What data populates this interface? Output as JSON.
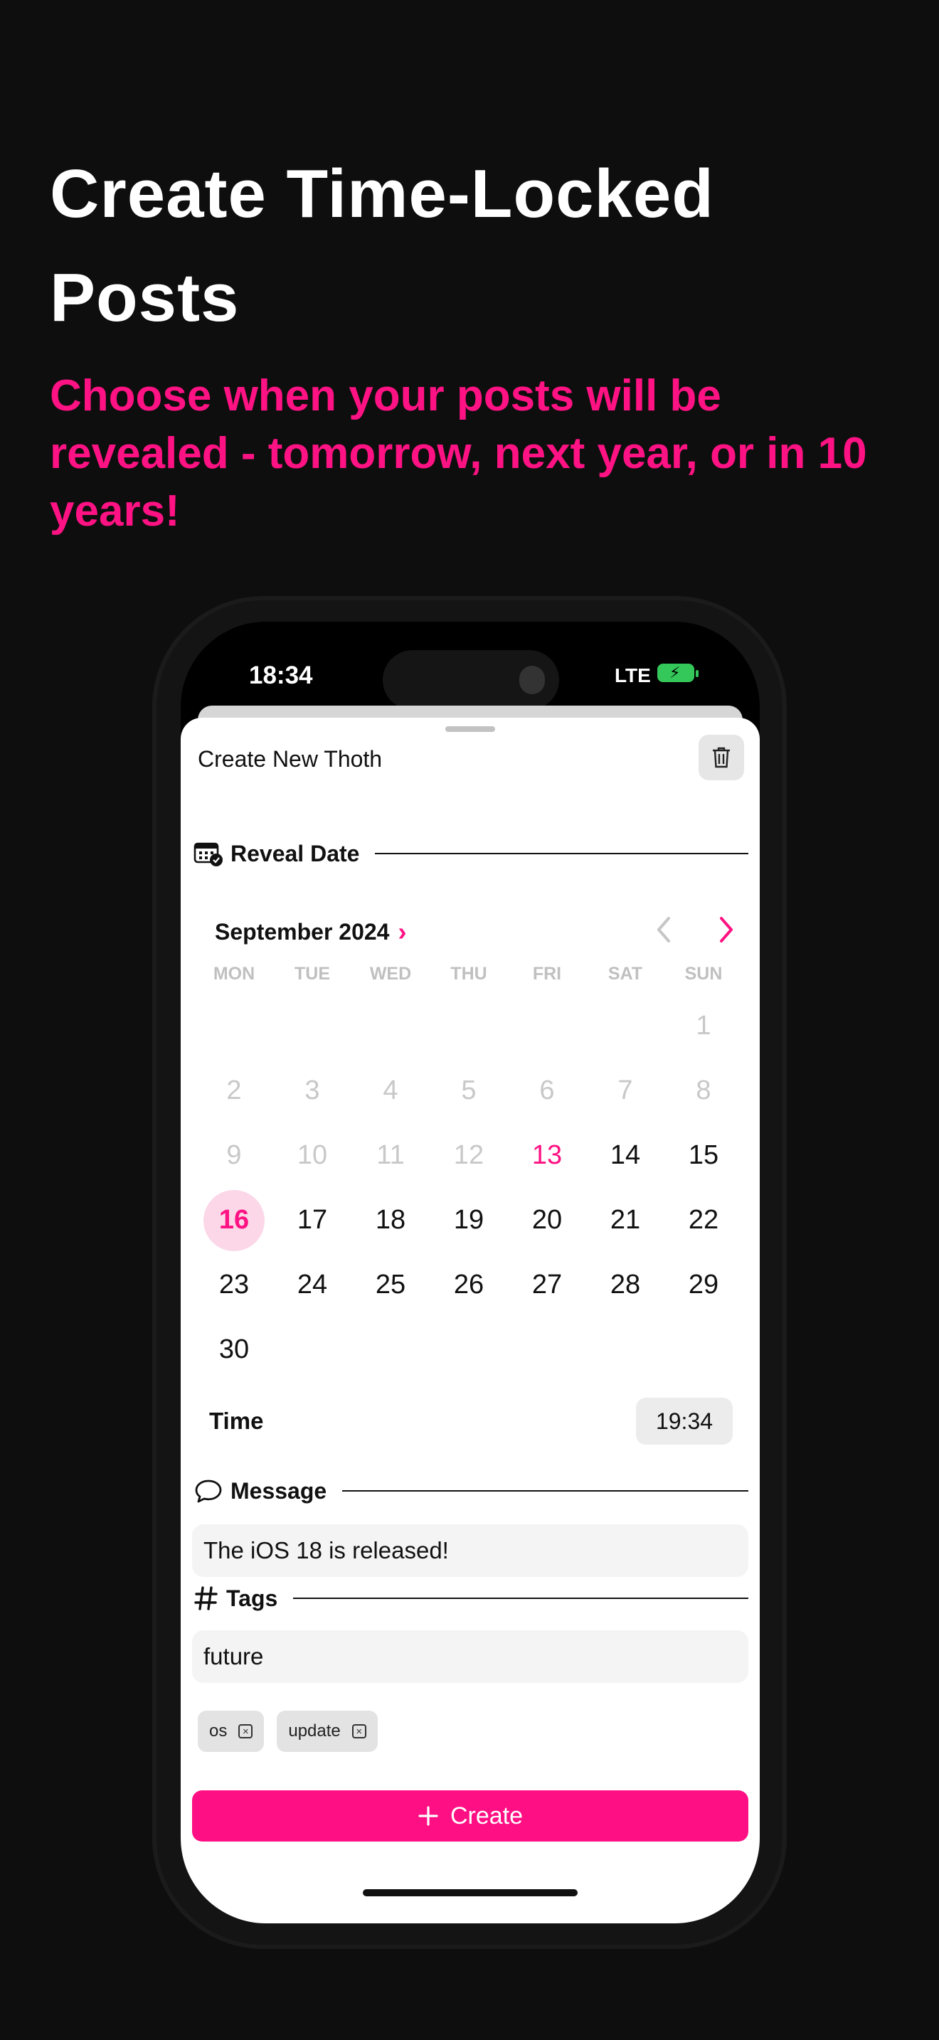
{
  "headline": "Create Time-Locked Posts",
  "subheadline": "Choose when your posts will be revealed - tomorrow, next year, or in 10 years!",
  "colors": {
    "accent": "#ff1283",
    "background": "#0e0e0e"
  },
  "status_bar": {
    "time": "18:34",
    "network": "LTE",
    "battery_icon": "battery-charging-icon"
  },
  "sheet": {
    "title": "Create New Thoth",
    "delete_icon": "trash-icon"
  },
  "reveal_date": {
    "label": "Reveal Date",
    "icon": "calendar-check-icon"
  },
  "calendar": {
    "month_label": "September 2024",
    "weekdays": [
      "MON",
      "TUE",
      "WED",
      "THU",
      "FRI",
      "SAT",
      "SUN"
    ],
    "days": [
      {
        "v": "",
        "s": "empty"
      },
      {
        "v": "",
        "s": "empty"
      },
      {
        "v": "",
        "s": "empty"
      },
      {
        "v": "",
        "s": "empty"
      },
      {
        "v": "",
        "s": "empty"
      },
      {
        "v": "",
        "s": "empty"
      },
      {
        "v": "1",
        "s": "dim"
      },
      {
        "v": "2",
        "s": "dim"
      },
      {
        "v": "3",
        "s": "dim"
      },
      {
        "v": "4",
        "s": "dim"
      },
      {
        "v": "5",
        "s": "dim"
      },
      {
        "v": "6",
        "s": "dim"
      },
      {
        "v": "7",
        "s": "dim"
      },
      {
        "v": "8",
        "s": "dim"
      },
      {
        "v": "9",
        "s": "dim"
      },
      {
        "v": "10",
        "s": "dim"
      },
      {
        "v": "11",
        "s": "dim"
      },
      {
        "v": "12",
        "s": "dim"
      },
      {
        "v": "13",
        "s": "today"
      },
      {
        "v": "14",
        "s": "normal"
      },
      {
        "v": "15",
        "s": "normal"
      },
      {
        "v": "16",
        "s": "sel"
      },
      {
        "v": "17",
        "s": "normal"
      },
      {
        "v": "18",
        "s": "normal"
      },
      {
        "v": "19",
        "s": "normal"
      },
      {
        "v": "20",
        "s": "normal"
      },
      {
        "v": "21",
        "s": "normal"
      },
      {
        "v": "22",
        "s": "normal"
      },
      {
        "v": "23",
        "s": "normal"
      },
      {
        "v": "24",
        "s": "normal"
      },
      {
        "v": "25",
        "s": "normal"
      },
      {
        "v": "26",
        "s": "normal"
      },
      {
        "v": "27",
        "s": "normal"
      },
      {
        "v": "28",
        "s": "normal"
      },
      {
        "v": "29",
        "s": "normal"
      },
      {
        "v": "30",
        "s": "normal"
      }
    ]
  },
  "time": {
    "label": "Time",
    "value": "19:34"
  },
  "message": {
    "label": "Message",
    "icon": "speech-bubble-icon",
    "value": "The iOS 18 is released!"
  },
  "tags": {
    "label": "Tags",
    "icon": "hashtag-icon",
    "input_value": "future",
    "chips": [
      "os",
      "update"
    ]
  },
  "create_button": {
    "label": "Create",
    "icon": "plus-icon"
  }
}
